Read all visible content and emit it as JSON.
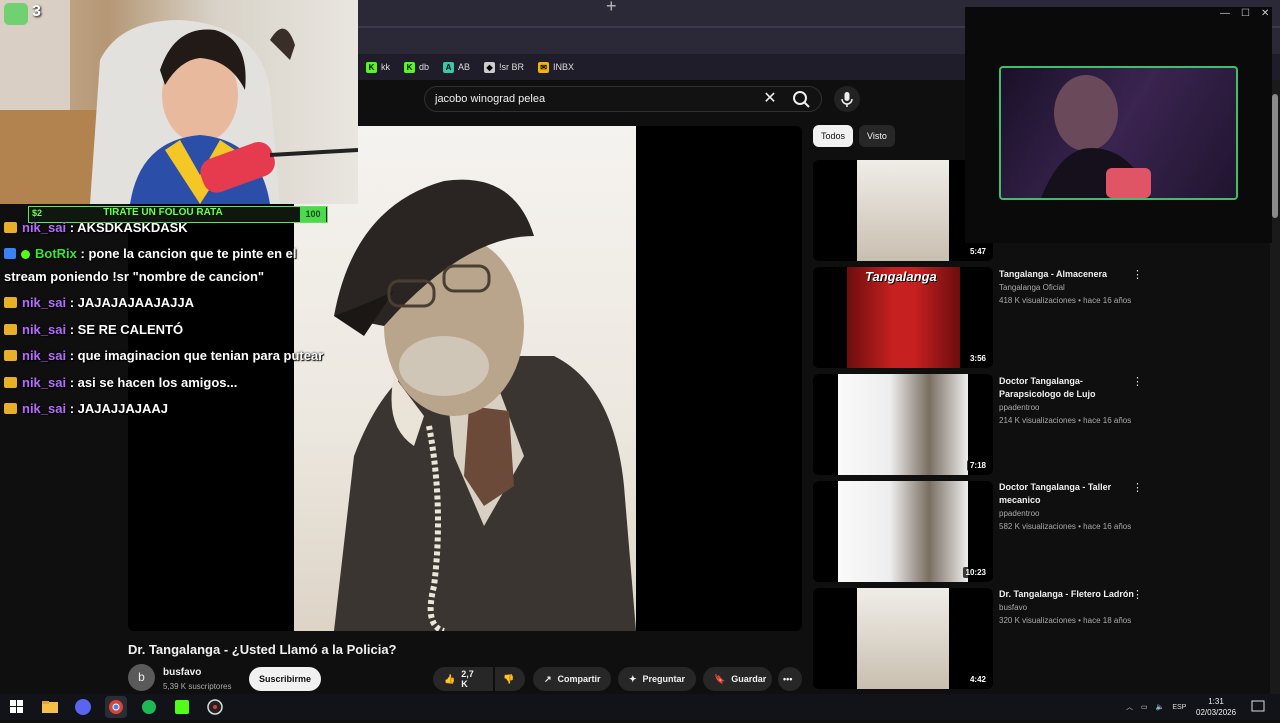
{
  "stream": {
    "viewer_count": "3",
    "goal": {
      "left": "$2",
      "label": "TIRATE UN FOLOU RATA",
      "right": "100"
    },
    "chat": [
      {
        "user": "nik_sai",
        "text": ": AKSDKASKDASK",
        "badge": "crown"
      },
      {
        "user": "BotRix",
        "text": ": pone la cancion que te pinte en el",
        "text2": "stream poniendo !sr \"nombre de cancion\"",
        "badge": "bot"
      },
      {
        "user": "nik_sai",
        "text": ": JAJAJAJAAJAJJA",
        "badge": "crown"
      },
      {
        "user": "nik_sai",
        "text": ": SE RE CALENTÓ",
        "badge": "crown"
      },
      {
        "user": "nik_sai",
        "text": ": que imaginacion que tenian para putear",
        "badge": "crown"
      },
      {
        "user": "nik_sai",
        "text": ": asi se hacen los amigos...",
        "badge": "crown"
      },
      {
        "user": "nik_sai",
        "text": ": JAJAJJAJAAJ",
        "badge": "crown"
      }
    ]
  },
  "bookmarks": [
    {
      "label": "kk",
      "color": "#53fc18",
      "icon": "kick-icon"
    },
    {
      "label": "db",
      "color": "#53fc18",
      "icon": "kick-icon"
    },
    {
      "label": "AB",
      "color": "#34c9a8",
      "icon": "app-icon"
    },
    {
      "label": "!sr BR",
      "color": "#cccccc",
      "icon": "diamond-icon"
    },
    {
      "label": "INBX",
      "color": "#f4b400",
      "icon": "inbox-icon"
    }
  ],
  "youtube": {
    "search_query": "jacobo winograd pelea",
    "video": {
      "title": "Dr. Tangalanga - ¿Usted Llamó a la Policia?",
      "channel": "busfavo",
      "channel_initial": "b",
      "subscribers": "5,39 K suscriptores",
      "subscribe_label": "Suscribirme",
      "likes": "2,7 K",
      "share_label": "Compartir",
      "ask_label": "Preguntar",
      "save_label": "Guardar"
    },
    "chips": [
      "Todos",
      "Visto"
    ],
    "recommendations": [
      {
        "title": "",
        "channel": "",
        "meta": "",
        "duration": "5:47"
      },
      {
        "title": "Tangalanga - Almacenera",
        "channel": "Tangalanga Oficial",
        "meta": "418 K visualizaciones • hace 16 años",
        "duration": "3:56",
        "thumb_text": "Tangalanga"
      },
      {
        "title": "Doctor Tangalanga- Parapsicologo de Lujo",
        "channel": "ppadentroo",
        "meta": "214 K visualizaciones • hace 16 años",
        "duration": "7:18"
      },
      {
        "title": "Doctor Tangalanga - Taller mecanico",
        "channel": "ppadentroo",
        "meta": "582 K visualizaciones • hace 16 años",
        "duration": "10:23"
      },
      {
        "title": "Dr. Tangalanga - Fletero Ladrón",
        "channel": "busfavo",
        "meta": "320 K visualizaciones • hace 18 años",
        "duration": "4:42"
      }
    ]
  },
  "taskbar": {
    "language": "ESP",
    "time": "1:31",
    "date": "02/03/2026"
  }
}
